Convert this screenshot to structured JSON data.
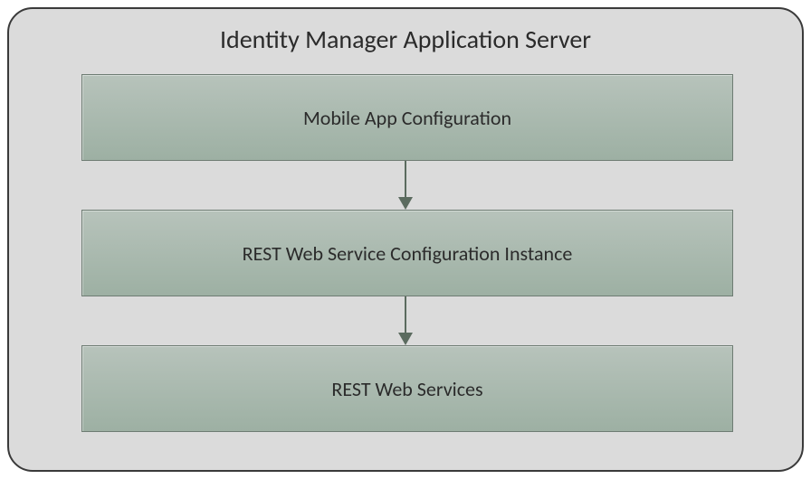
{
  "diagram": {
    "title": "Identity Manager Application Server",
    "nodes": [
      {
        "id": "mobile-app-config",
        "label": "Mobile App Configuration"
      },
      {
        "id": "rest-config-instance",
        "label": "REST Web Service Configuration Instance"
      },
      {
        "id": "rest-web-services",
        "label": "REST Web Services"
      }
    ],
    "edges": [
      {
        "from": "mobile-app-config",
        "to": "rest-config-instance"
      },
      {
        "from": "rest-config-instance",
        "to": "rest-web-services"
      }
    ],
    "colors": {
      "container_bg": "#dbdbdb",
      "container_border": "#3a3a3a",
      "node_fill_top": "#b7c3bb",
      "node_fill_bottom": "#9db0a3",
      "node_border": "#6e7c73",
      "arrow": "#5b6b5f"
    }
  }
}
